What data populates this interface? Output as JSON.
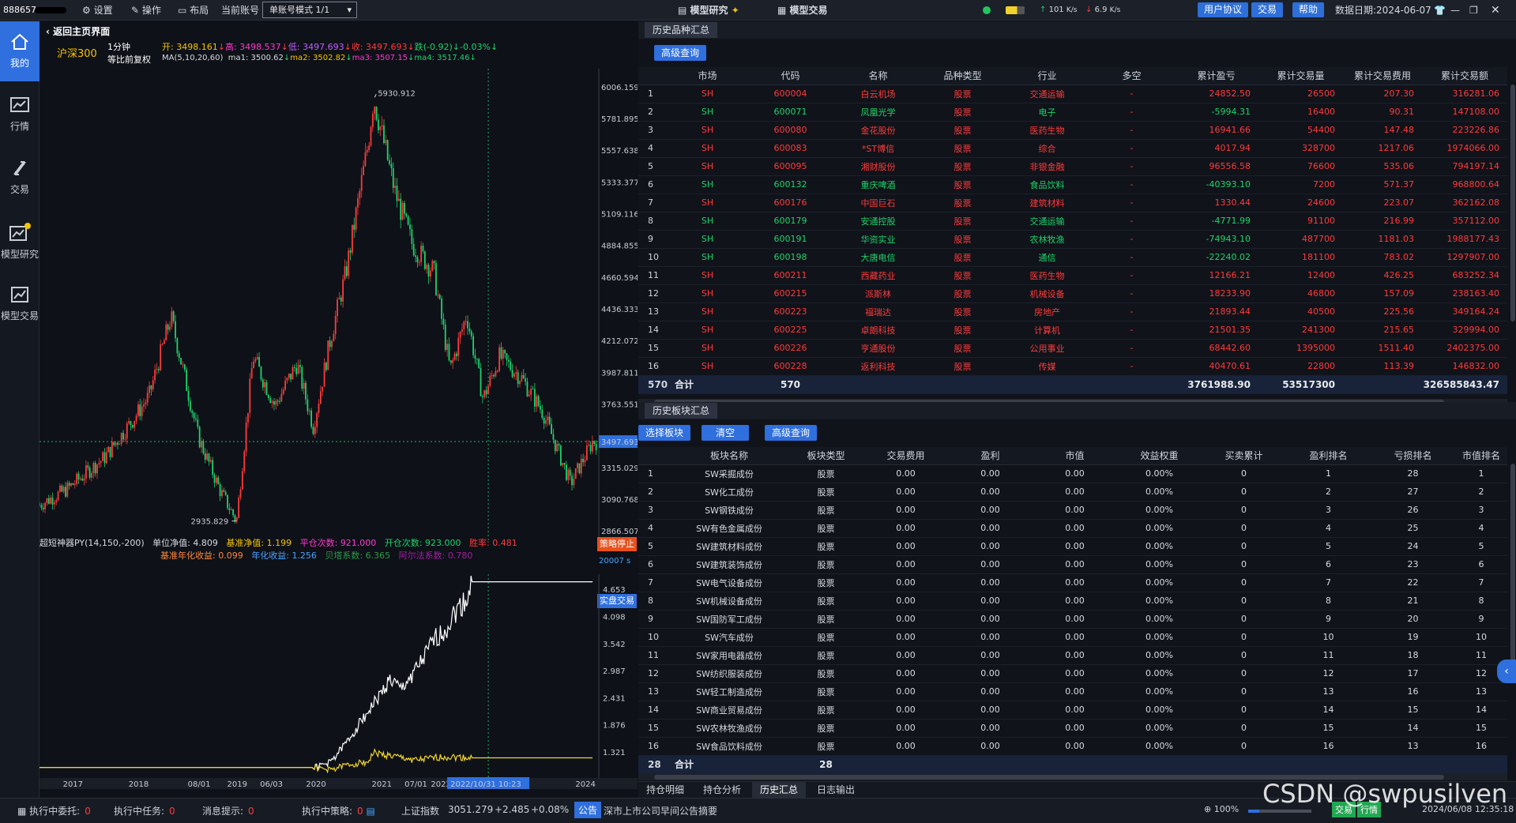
{
  "topbar": {
    "account_id": "888657",
    "settings": "设置",
    "operate": "操作",
    "layout": "布局",
    "current_account": "当前账号",
    "mode_select": "单账号模式 1/1",
    "model_research": "模型研究",
    "model_trade": "模型交易",
    "net_up": "101",
    "net_up_unit": "K/s",
    "net_down": "6.9",
    "net_down_unit": "K/s",
    "user_agreement": "用户协议",
    "trade": "交易",
    "help": "帮助",
    "data_date": "数据日期:2024-06-07"
  },
  "sidebar": [
    {
      "label": "我的",
      "icon": "home-icon",
      "active": true
    },
    {
      "label": "行情",
      "icon": "market-chart-icon",
      "active": false
    },
    {
      "label": "交易",
      "icon": "trade-arrows-icon",
      "active": false
    },
    {
      "label": "模型研究",
      "icon": "model-research-icon",
      "active": false
    },
    {
      "label": "模型交易",
      "icon": "model-trade-icon",
      "active": false
    }
  ],
  "left": {
    "back_label": "返回主页界面",
    "symbol": "沪深300",
    "period": "1分钟",
    "adjust": "等比前复权",
    "ohlc": {
      "open_label": "开",
      "open": "3498.161",
      "high_label": "高",
      "high": "3498.537",
      "low_label": "低",
      "low": "3497.693",
      "close_label": "收",
      "close": "3497.693",
      "chg_label": "跌",
      "chg": "(-0.92)",
      "pct": "-0.03%"
    },
    "ma": {
      "label": "MA(5,10,20,60)",
      "ma1_label": "ma1",
      "ma1": "3500.62",
      "ma2_label": "ma2",
      "ma2": "3502.82",
      "ma3_label": "ma3",
      "ma3": "3507.15",
      "ma4_label": "ma4",
      "ma4": "3517.46"
    },
    "indicator": {
      "name": "超短神器PY(14,150,-200)",
      "unit_nav_label": "单位净值",
      "unit_nav": "4.809",
      "bench_nav_label": "基准净值",
      "bench_nav": "1.199",
      "open_count_label": "平仓次数",
      "open_count": "921.000",
      "close_count_label": "开仓次数",
      "close_count": "923.000",
      "winrate_label": "胜率",
      "winrate": "0.481",
      "bench_annual_label": "基准年化收益",
      "bench_annual": "0.099",
      "annual_label": "年化收益",
      "annual": "1.256",
      "beta_label": "贝塔系数",
      "beta": "6.365",
      "alpha_label": "阿尔法系数",
      "alpha": "0.780"
    },
    "strategy_stop": "策略停止",
    "timer": "20007 s",
    "live_trade": "实盘交易",
    "crosshair_date": "2022/10/31 10:23"
  },
  "chart_data": [
    {
      "type": "candlestick",
      "title": "沪深300 1分钟",
      "y_ticks": [
        6006.159,
        5781.895,
        5557.638,
        5333.377,
        5109.116,
        4884.855,
        4660.594,
        4436.333,
        4212.072,
        3987.811,
        3763.551,
        3315.029,
        3090.768,
        2866.507
      ],
      "current_price": "3497.693",
      "annotations": [
        {
          "label": "5930.912",
          "kind": "max"
        },
        {
          "label": "2935.829",
          "kind": "min"
        }
      ],
      "x_ticks": [
        "2017",
        "2018",
        "08/01",
        "2019",
        "06/03",
        "2020",
        "2021",
        "07/01",
        "2022",
        "2024"
      ],
      "close_trend": [
        {
          "x": "2016-01",
          "y": 3050
        },
        {
          "x": "2016-06",
          "y": 3160
        },
        {
          "x": "2017-01",
          "y": 3390
        },
        {
          "x": "2017-06",
          "y": 3650
        },
        {
          "x": "2017-09",
          "y": 3820
        },
        {
          "x": "2018-01",
          "y": 4380
        },
        {
          "x": "2018-06",
          "y": 3530
        },
        {
          "x": "2018-10",
          "y": 3150
        },
        {
          "x": "2019-01",
          "y": 2936
        },
        {
          "x": "2019-04",
          "y": 4100
        },
        {
          "x": "2019-08",
          "y": 3750
        },
        {
          "x": "2019-12",
          "y": 4050
        },
        {
          "x": "2020-03",
          "y": 3600
        },
        {
          "x": "2020-06",
          "y": 4200
        },
        {
          "x": "2020-09",
          "y": 4700
        },
        {
          "x": "2021-01",
          "y": 5600
        },
        {
          "x": "2021-02",
          "y": 5931
        },
        {
          "x": "2021-06",
          "y": 5250
        },
        {
          "x": "2021-09",
          "y": 4900
        },
        {
          "x": "2022-01",
          "y": 4700
        },
        {
          "x": "2022-04",
          "y": 4000
        },
        {
          "x": "2022-07",
          "y": 4400
        },
        {
          "x": "2022-10",
          "y": 3800
        },
        {
          "x": "2023-01",
          "y": 4100
        },
        {
          "x": "2023-05",
          "y": 3950
        },
        {
          "x": "2023-09",
          "y": 3700
        },
        {
          "x": "2024-02",
          "y": 3200
        },
        {
          "x": "2024-06",
          "y": 3498
        }
      ]
    },
    {
      "type": "line",
      "title": "超短神器PY(14,150,-200)",
      "y_ticks": [
        4.653,
        4.098,
        3.542,
        2.987,
        2.431,
        1.876,
        1.321
      ],
      "series": [
        {
          "name": "单位净值",
          "color": "#ffffff",
          "points": [
            {
              "x": "2016-01",
              "y": 1.0
            },
            {
              "x": "2020-03",
              "y": 1.0
            },
            {
              "x": "2020-06",
              "y": 1.1
            },
            {
              "x": "2020-09",
              "y": 1.5
            },
            {
              "x": "2020-12",
              "y": 2.0
            },
            {
              "x": "2021-03",
              "y": 2.45
            },
            {
              "x": "2021-05",
              "y": 2.8
            },
            {
              "x": "2021-07",
              "y": 2.6
            },
            {
              "x": "2021-09",
              "y": 2.9
            },
            {
              "x": "2021-11",
              "y": 3.2
            },
            {
              "x": "2022-01",
              "y": 3.6
            },
            {
              "x": "2022-03",
              "y": 3.8
            },
            {
              "x": "2022-05",
              "y": 4.2
            },
            {
              "x": "2022-07",
              "y": 4.45
            },
            {
              "x": "2022-08",
              "y": 4.809
            },
            {
              "x": "2024-06",
              "y": 4.809
            }
          ]
        },
        {
          "name": "基准净值",
          "color": "#f1d52c",
          "points": [
            {
              "x": "2016-01",
              "y": 1.0
            },
            {
              "x": "2020-03",
              "y": 1.0
            },
            {
              "x": "2020-06",
              "y": 0.95
            },
            {
              "x": "2020-09",
              "y": 1.05
            },
            {
              "x": "2021-01",
              "y": 1.12
            },
            {
              "x": "2021-02",
              "y": 1.3
            },
            {
              "x": "2021-06",
              "y": 1.22
            },
            {
              "x": "2021-10",
              "y": 1.15
            },
            {
              "x": "2022-03",
              "y": 1.22
            },
            {
              "x": "2022-08",
              "y": 1.199
            },
            {
              "x": "2024-06",
              "y": 1.199
            }
          ]
        }
      ]
    }
  ],
  "history_symbols": {
    "tab": "历史品种汇总",
    "query_btn": "高级查询",
    "columns": [
      "",
      "市场",
      "代码",
      "名称",
      "品种类型",
      "行业",
      "多空",
      "累计盈亏",
      "累计交易量",
      "累计交易费用",
      "累计交易额"
    ],
    "rows": [
      [
        "1",
        "SH",
        "600004",
        "白云机场",
        "股票",
        "交通运输",
        "-",
        "24852.50",
        "26500",
        "207.30",
        "316281.06"
      ],
      [
        "2",
        "SH",
        "600071",
        "凤凰光学",
        "股票",
        "电子",
        "-",
        "-5994.31",
        "16400",
        "90.31",
        "147108.00"
      ],
      [
        "3",
        "SH",
        "600080",
        "金花股份",
        "股票",
        "医药生物",
        "-",
        "16941.66",
        "54400",
        "147.48",
        "223226.86"
      ],
      [
        "4",
        "SH",
        "600083",
        "*ST博信",
        "股票",
        "综合",
        "-",
        "4017.94",
        "328700",
        "1217.06",
        "1974066.00"
      ],
      [
        "5",
        "SH",
        "600095",
        "湘财股份",
        "股票",
        "非银金融",
        "-",
        "96556.58",
        "76600",
        "535.06",
        "794197.14"
      ],
      [
        "6",
        "SH",
        "600132",
        "重庆啤酒",
        "股票",
        "食品饮料",
        "-",
        "-40393.10",
        "7200",
        "571.37",
        "968800.64"
      ],
      [
        "7",
        "SH",
        "600176",
        "中国巨石",
        "股票",
        "建筑材料",
        "-",
        "1330.44",
        "24600",
        "223.07",
        "362162.08"
      ],
      [
        "8",
        "SH",
        "600179",
        "安通控股",
        "股票",
        "交通运输",
        "-",
        "-4771.99",
        "91100",
        "216.99",
        "357112.00"
      ],
      [
        "9",
        "SH",
        "600191",
        "华资实业",
        "股票",
        "农林牧渔",
        "-",
        "-74943.10",
        "487700",
        "1181.03",
        "1988177.43"
      ],
      [
        "10",
        "SH",
        "600198",
        "大唐电信",
        "股票",
        "通信",
        "-",
        "-22240.02",
        "181100",
        "783.02",
        "1297907.00"
      ],
      [
        "11",
        "SH",
        "600211",
        "西藏药业",
        "股票",
        "医药生物",
        "-",
        "12166.21",
        "12400",
        "426.25",
        "683252.34"
      ],
      [
        "12",
        "SH",
        "600215",
        "派斯林",
        "股票",
        "机械设备",
        "-",
        "18233.90",
        "46800",
        "157.09",
        "238163.40"
      ],
      [
        "13",
        "SH",
        "600223",
        "福瑞达",
        "股票",
        "房地产",
        "-",
        "21893.44",
        "40500",
        "225.56",
        "349164.24"
      ],
      [
        "14",
        "SH",
        "600225",
        "卓朗科技",
        "股票",
        "计算机",
        "-",
        "21501.35",
        "241300",
        "215.65",
        "329994.00"
      ],
      [
        "15",
        "SH",
        "600226",
        "亨通股份",
        "股票",
        "公用事业",
        "-",
        "68442.60",
        "1395000",
        "1511.40",
        "2402375.00"
      ],
      [
        "16",
        "SH",
        "600228",
        "返利科技",
        "股票",
        "传媒",
        "-",
        "40470.61",
        "22800",
        "113.39",
        "146832.00"
      ]
    ],
    "summary": {
      "count": "570",
      "label": "合计",
      "value": "570",
      "pnl": "3761988.90",
      "volume": "53517300",
      "amount": "326585843.47"
    }
  },
  "history_sectors": {
    "tab": "历史板块汇总",
    "select_btn": "选择板块",
    "clear_btn": "清空",
    "query_btn": "高级查询",
    "columns": [
      "",
      "板块名称",
      "板块类型",
      "交易费用",
      "盈利",
      "市值",
      "效益权重",
      "买卖累计",
      "盈利排名",
      "亏损排名",
      "市值排名"
    ],
    "rows": [
      [
        "1",
        "SW采掘成份",
        "股票",
        "0.00",
        "0.00",
        "0.00",
        "0.00%",
        "0",
        "1",
        "28",
        "1"
      ],
      [
        "2",
        "SW化工成份",
        "股票",
        "0.00",
        "0.00",
        "0.00",
        "0.00%",
        "0",
        "2",
        "27",
        "2"
      ],
      [
        "3",
        "SW钢铁成份",
        "股票",
        "0.00",
        "0.00",
        "0.00",
        "0.00%",
        "0",
        "3",
        "26",
        "3"
      ],
      [
        "4",
        "SW有色金属成份",
        "股票",
        "0.00",
        "0.00",
        "0.00",
        "0.00%",
        "0",
        "4",
        "25",
        "4"
      ],
      [
        "5",
        "SW建筑材料成份",
        "股票",
        "0.00",
        "0.00",
        "0.00",
        "0.00%",
        "0",
        "5",
        "24",
        "5"
      ],
      [
        "6",
        "SW建筑装饰成份",
        "股票",
        "0.00",
        "0.00",
        "0.00",
        "0.00%",
        "0",
        "6",
        "23",
        "6"
      ],
      [
        "7",
        "SW电气设备成份",
        "股票",
        "0.00",
        "0.00",
        "0.00",
        "0.00%",
        "0",
        "7",
        "22",
        "7"
      ],
      [
        "8",
        "SW机械设备成份",
        "股票",
        "0.00",
        "0.00",
        "0.00",
        "0.00%",
        "0",
        "8",
        "21",
        "8"
      ],
      [
        "9",
        "SW国防军工成份",
        "股票",
        "0.00",
        "0.00",
        "0.00",
        "0.00%",
        "0",
        "9",
        "20",
        "9"
      ],
      [
        "10",
        "SW汽车成份",
        "股票",
        "0.00",
        "0.00",
        "0.00",
        "0.00%",
        "0",
        "10",
        "19",
        "10"
      ],
      [
        "11",
        "SW家用电器成份",
        "股票",
        "0.00",
        "0.00",
        "0.00",
        "0.00%",
        "0",
        "11",
        "18",
        "11"
      ],
      [
        "12",
        "SW纺织服装成份",
        "股票",
        "0.00",
        "0.00",
        "0.00",
        "0.00%",
        "0",
        "12",
        "17",
        "12"
      ],
      [
        "13",
        "SW轻工制造成份",
        "股票",
        "0.00",
        "0.00",
        "0.00",
        "0.00%",
        "0",
        "13",
        "16",
        "13"
      ],
      [
        "14",
        "SW商业贸易成份",
        "股票",
        "0.00",
        "0.00",
        "0.00",
        "0.00%",
        "0",
        "14",
        "15",
        "14"
      ],
      [
        "15",
        "SW农林牧渔成份",
        "股票",
        "0.00",
        "0.00",
        "0.00",
        "0.00%",
        "0",
        "15",
        "14",
        "15"
      ],
      [
        "16",
        "SW食品饮料成份",
        "股票",
        "0.00",
        "0.00",
        "0.00",
        "0.00%",
        "0",
        "16",
        "13",
        "16"
      ]
    ],
    "summary": {
      "count": "28",
      "label": "合计",
      "value": "28"
    }
  },
  "bottom_tabs": [
    "持仓明细",
    "持仓分析",
    "历史汇总",
    "日志输出"
  ],
  "status": {
    "pending_orders": "执行中委托:",
    "pending_orders_n": "0",
    "tasks": "执行中任务:",
    "tasks_n": "0",
    "messages": "消息提示:",
    "messages_n": "0",
    "strategies": "执行中策略:",
    "strategies_n": "0",
    "index_name": "上证指数",
    "index_value": "3051.279",
    "index_chg": "+2.485",
    "index_pct": "+0.08%",
    "notice_label": "公告",
    "notice_text": "深市上市公司早间公告摘要",
    "zoom": "100%",
    "trade_btn": "交易",
    "market_btn": "行情",
    "datetime": "2024/06/08 12:35:18"
  },
  "watermark": "CSDN @swpusilven"
}
